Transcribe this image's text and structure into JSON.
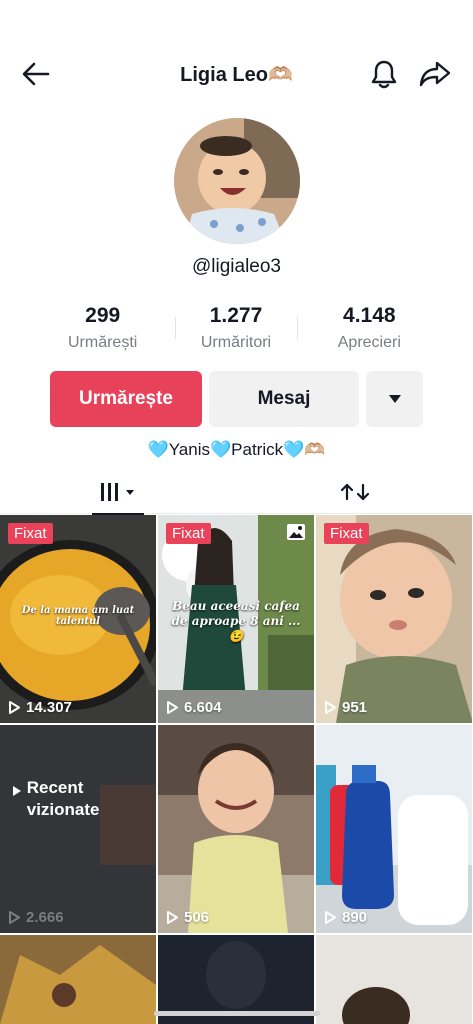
{
  "header": {
    "title": "Ligia Leo🫶🏼",
    "back_icon": "arrow-left-icon",
    "bell_icon": "bell-icon",
    "share_icon": "share-arrow-icon"
  },
  "profile": {
    "username": "@ligialeo3",
    "bio": "🩵Yanis🩵Patrick🩵🫶🏼"
  },
  "stats": [
    {
      "value": "299",
      "label": "Urmărești"
    },
    {
      "value": "1.277",
      "label": "Urmăritori"
    },
    {
      "value": "4.148",
      "label": "Aprecieri"
    }
  ],
  "actions": {
    "follow_label": "Urmărește",
    "message_label": "Mesaj",
    "more_icon": "caret-down-icon"
  },
  "colors": {
    "accent": "#e8425a",
    "text": "#161823",
    "muted": "#7b7d85"
  },
  "tabs": {
    "videos_icon": "grid-bars-icon",
    "repost_icon": "repost-icon"
  },
  "videos": [
    {
      "pinned": "Fixat",
      "views": "14.307",
      "caption": "De la mama am luat talentul"
    },
    {
      "pinned": "Fixat",
      "views": "6.604",
      "caption": "Beau aceeasi cafea de aproape 8 ani ...😉"
    },
    {
      "pinned": "Fixat",
      "views": "951"
    },
    {
      "views": "2.666",
      "recent_label": "Recent vizionate"
    },
    {
      "views": "506"
    },
    {
      "views": "890"
    }
  ]
}
